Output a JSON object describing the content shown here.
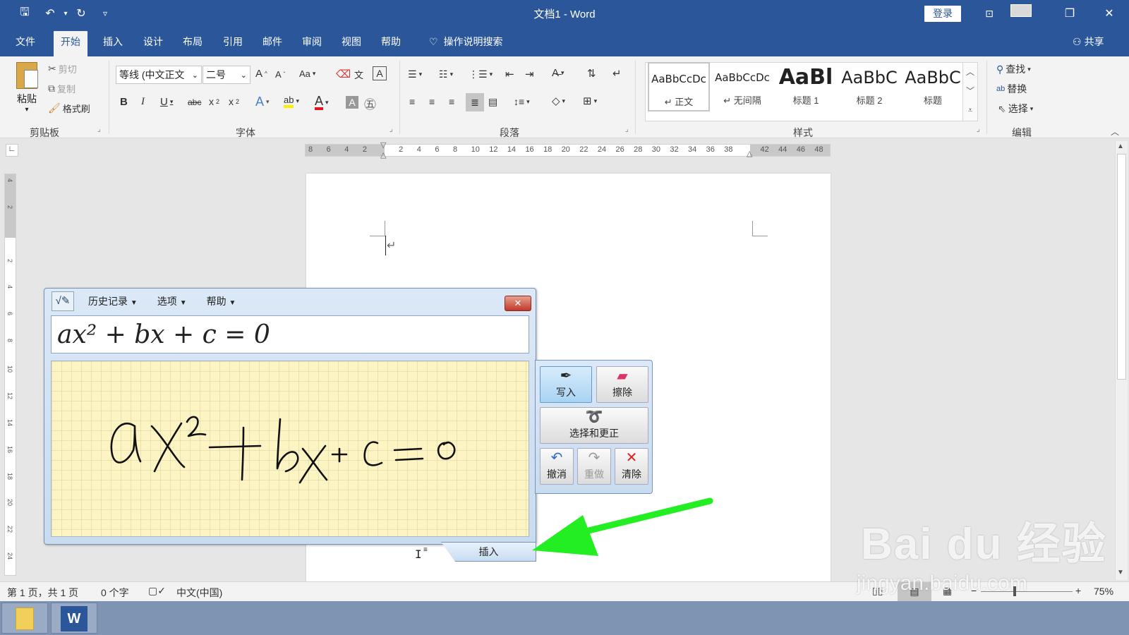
{
  "window": {
    "title": "文档1 - Word",
    "login": "登录"
  },
  "tabs": [
    "文件",
    "开始",
    "插入",
    "设计",
    "布局",
    "引用",
    "邮件",
    "审阅",
    "视图",
    "帮助"
  ],
  "tell_me": "操作说明搜索",
  "share": "共享",
  "clipboard": {
    "paste": "粘贴",
    "cut": "剪切",
    "copy": "复制",
    "format_painter": "格式刷",
    "label": "剪贴板"
  },
  "font": {
    "name": "等线 (中文正文",
    "size": "二号",
    "change_case": "Aa",
    "label": "字体"
  },
  "paragraph": {
    "label": "段落"
  },
  "styles": {
    "items": [
      {
        "sample": "AaBbCcDc",
        "label": "↵ 正文"
      },
      {
        "sample": "AaBbCcDc",
        "label": "↵ 无间隔"
      },
      {
        "sample": "AaBl",
        "label": "标题 1"
      },
      {
        "sample": "AaBbC",
        "label": "标题 2"
      },
      {
        "sample": "AaBbC",
        "label": "标题"
      }
    ],
    "label": "样式"
  },
  "editing": {
    "find": "查找",
    "replace": "替换",
    "select": "选择",
    "label": "编辑"
  },
  "ruler": {
    "ticks": [
      "8",
      "6",
      "4",
      "2",
      "",
      "2",
      "4",
      "6",
      "8",
      "10",
      "12",
      "14",
      "16",
      "18",
      "20",
      "22",
      "24",
      "26",
      "28",
      "30",
      "32",
      "34",
      "36",
      "38",
      "",
      "42",
      "44",
      "46",
      "48"
    ]
  },
  "vruler": {
    "ticks": [
      "4",
      "2",
      "",
      "2",
      "4",
      "6",
      "8",
      "10",
      "12",
      "14",
      "16",
      "18",
      "20",
      "22",
      "24"
    ]
  },
  "math_panel": {
    "menu": {
      "history": "历史记录",
      "options": "选项",
      "help": "帮助"
    },
    "preview": "ax² + bx + c = 0",
    "buttons": {
      "write": "写入",
      "erase": "擦除",
      "select_correct": "选择和更正",
      "undo": "撤消",
      "redo": "重做",
      "clear": "清除"
    },
    "insert": "插入"
  },
  "status": {
    "page": "第 1 页，共 1 页",
    "words": "0 个字",
    "language": "中文(中国)",
    "zoom": "75%"
  },
  "watermark": {
    "brand": "Bai du 经验",
    "url": "jingyan.baidu.com"
  },
  "colors": {
    "word_blue": "#2b579a",
    "arrow": "#22ee22",
    "font_color": "#e81123",
    "highlight": "#ffee00"
  }
}
